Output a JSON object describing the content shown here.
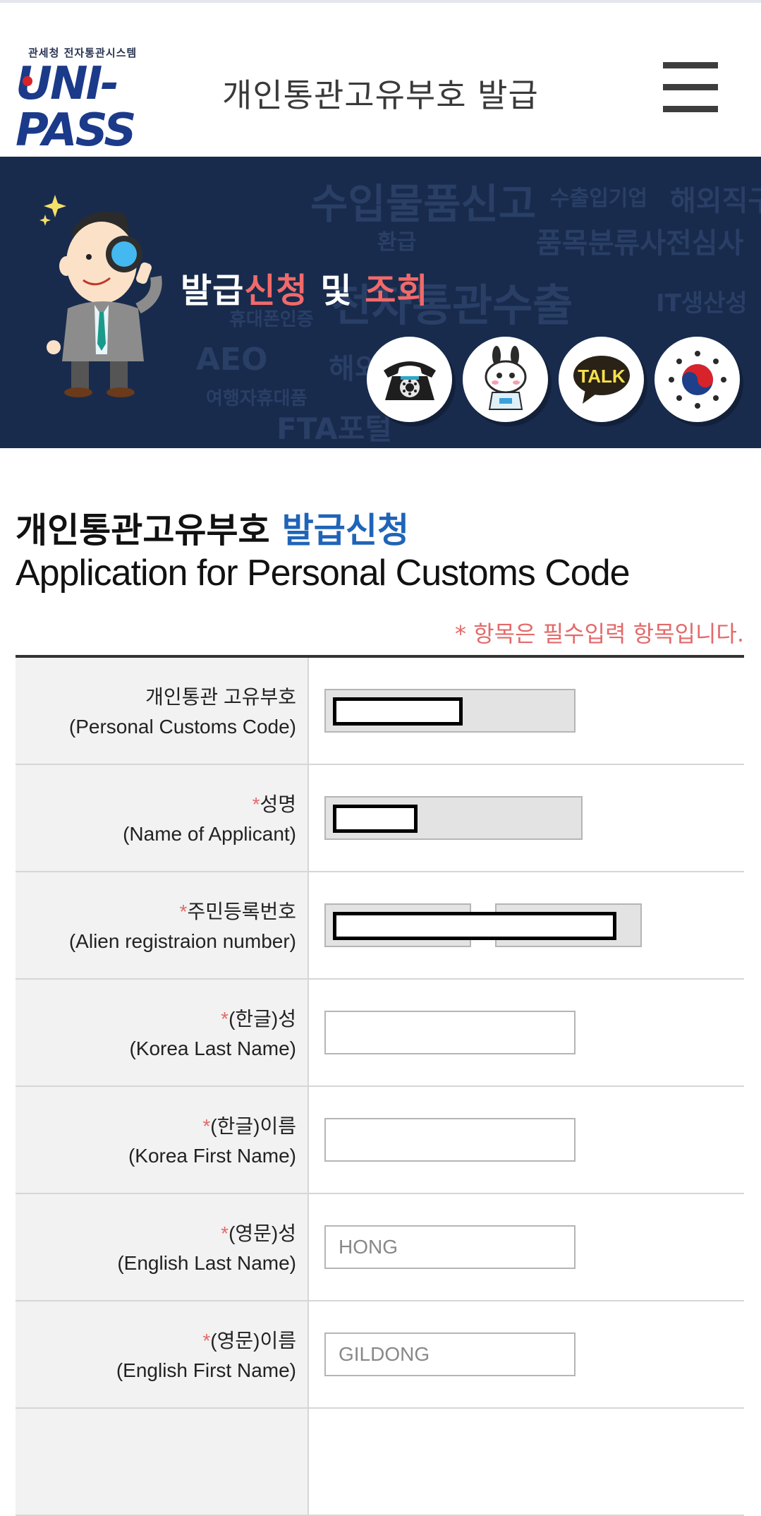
{
  "header": {
    "logo_small_text": "관세청 전자통관시스템",
    "logo_text": "UNI-PASS",
    "title": "개인통관고유부호  발급"
  },
  "banner": {
    "title_part1": "발급",
    "title_part2": "신청",
    "title_part3": " 및 ",
    "title_part4": "조회",
    "background_words": [
      "수입물품신고",
      "수출입기업",
      "해외직구",
      "환급",
      "품목분류사전심사",
      "전자통관수출",
      "IT생산성",
      "휴대폰인증",
      "AEO",
      "여행자휴대품",
      "FTA포털",
      "해외직구"
    ],
    "circle_buttons": [
      {
        "icon": "telephone-icon"
      },
      {
        "icon": "rabbit-mascot-icon"
      },
      {
        "icon": "kakao-talk-icon",
        "label": "TALK"
      },
      {
        "icon": "korea-gov-emblem-icon"
      }
    ]
  },
  "section": {
    "title_black": "개인통관고유부호 ",
    "title_blue": "발급신청",
    "subtitle": "Application for Personal Customs Code",
    "required_note": "* 항목은 필수입력 항목입니다."
  },
  "form": {
    "rows": [
      {
        "star": "",
        "label_ko": "개인통관 고유부호",
        "label_en": "(Personal Customs Code)",
        "value": "",
        "readonly": true
      },
      {
        "star": "*",
        "label_ko": "성명",
        "label_en": "(Name of Applicant)",
        "value": "",
        "readonly": true
      },
      {
        "star": "*",
        "label_ko": "주민등록번호",
        "label_en": "(Alien registraion number)",
        "value": "",
        "readonly": true
      },
      {
        "star": "*",
        "label_ko": "(한글)성",
        "label_en": "(Korea Last Name)",
        "value": "",
        "readonly": false
      },
      {
        "star": "*",
        "label_ko": "(한글)이름",
        "label_en": "(Korea First Name)",
        "value": "",
        "readonly": false
      },
      {
        "star": "*",
        "label_ko": "(영문)성",
        "label_en": "(English Last Name)",
        "placeholder": "HONG",
        "readonly": false
      },
      {
        "star": "*",
        "label_ko": "(영문)이름",
        "label_en": "(English First Name)",
        "placeholder": "GILDONG",
        "readonly": false
      }
    ]
  },
  "colors": {
    "banner_bg": "#182b4d",
    "accent_red": "#f06a6a",
    "accent_blue": "#1f64b8",
    "required_red": "#e36a6a"
  }
}
